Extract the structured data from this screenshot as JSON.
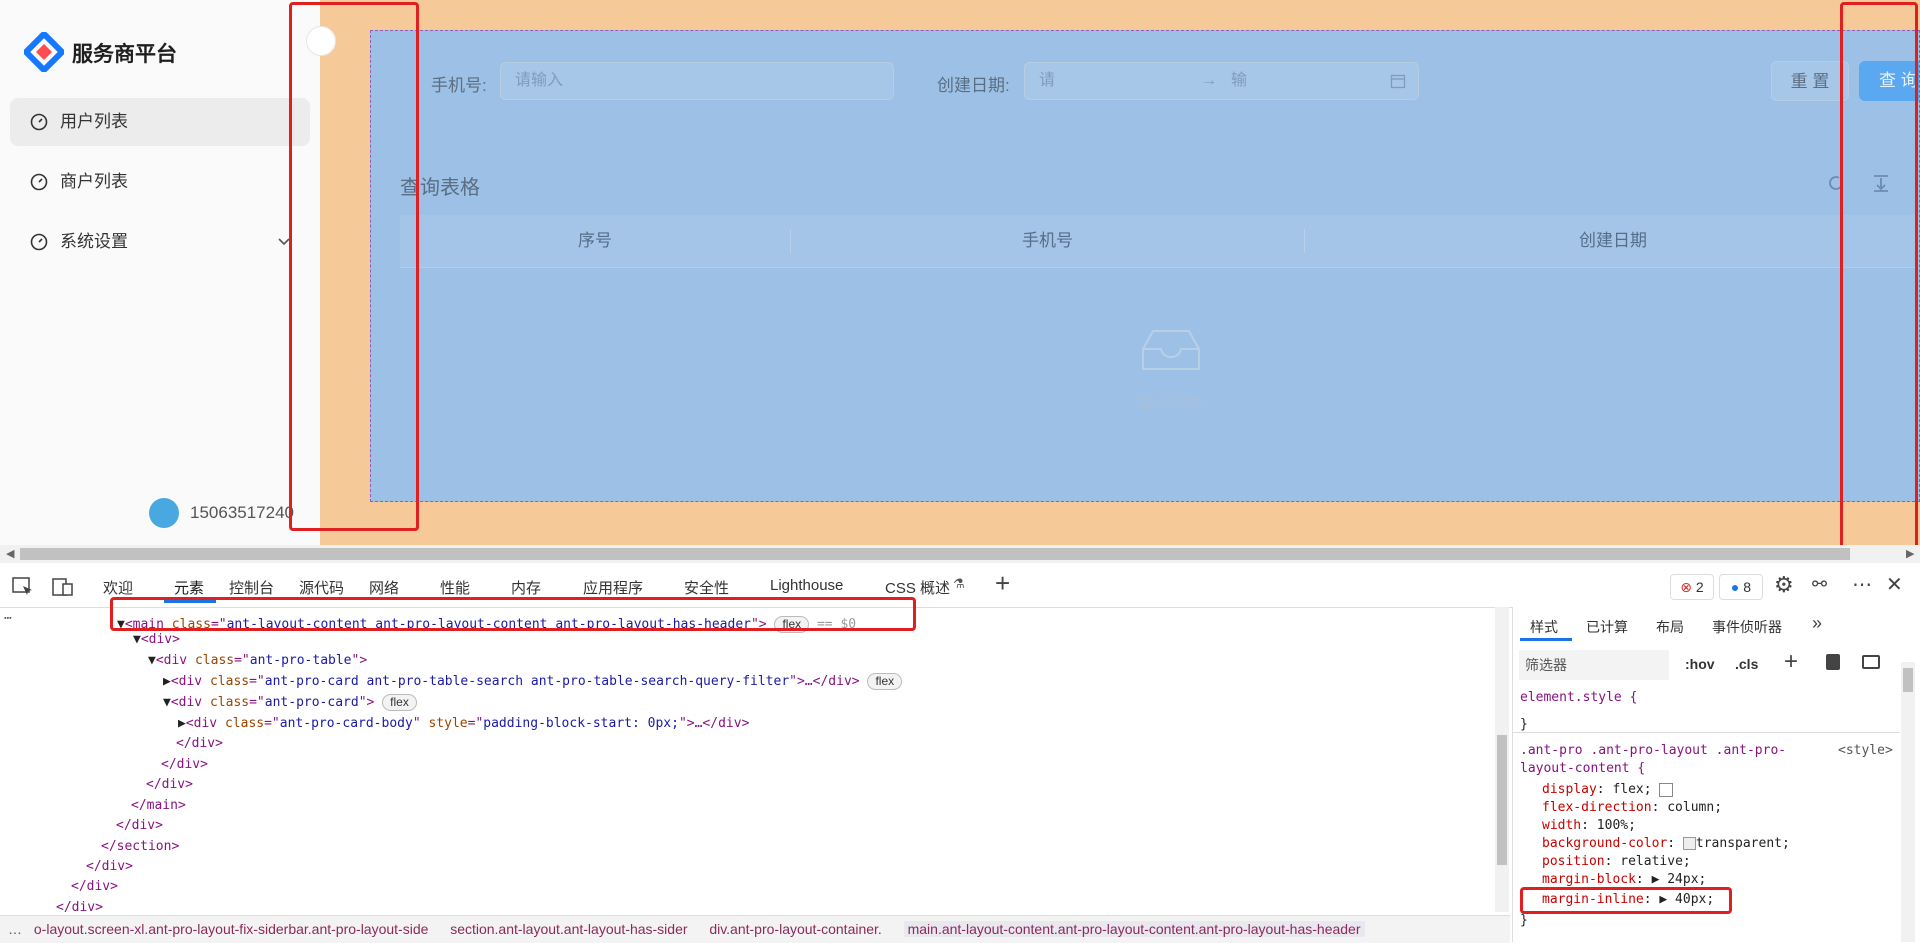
{
  "app": {
    "logo_text": "服务商平台",
    "menu": [
      {
        "label": "用户列表",
        "active": true
      },
      {
        "label": "商户列表",
        "active": false
      },
      {
        "label": "系统设置",
        "active": false,
        "has_submenu": true
      }
    ],
    "user_name": "15063517240",
    "search": {
      "phone_label": "手机号:",
      "phone_placeholder": "请输入",
      "date_label": "创建日期:",
      "date_start_placeholder": "请",
      "date_arrow": "→",
      "date_end_placeholder": "输",
      "reset_label": "重 置",
      "query_label": "查 询"
    },
    "table": {
      "title": "查询表格",
      "columns": [
        "序号",
        "手机号",
        "创建日期"
      ],
      "empty_text": "暂无数据"
    },
    "colors": {
      "margin_overlay": "#f6c999",
      "content_overlay": "#9dc1e6",
      "annotation_red": "#e02020",
      "accent": "#1a73e8"
    }
  },
  "devtools": {
    "tabs": [
      "欢迎",
      "元素",
      "控制台",
      "源代码",
      "网络",
      "性能",
      "内存",
      "应用程序",
      "安全性",
      "Lighthouse",
      "CSS 概述"
    ],
    "active_tab": "元素",
    "error_count": "2",
    "message_count": "8",
    "dom_lines": {
      "l0_tag": "main",
      "l0_class": "ant-layout-content ant-pro-layout-content ant-pro-layout-has-header",
      "l0_badge": "flex",
      "l0_suffix": "== $0",
      "l1": "<div>",
      "l2_class": "ant-pro-table",
      "l3_class": "ant-pro-card ant-pro-table-search ant-pro-table-search-query-filter",
      "l3_badge": "flex",
      "l4_class": "ant-pro-card",
      "l4_badge": "flex",
      "l5_class": "ant-pro-card-body",
      "l5_style": "padding-block-start: 0px;",
      "close_div": "</div>",
      "close_main": "</main>",
      "close_section": "</section>"
    },
    "breadcrumb": [
      "o-layout.screen-xl.ant-pro-layout-fix-siderbar.ant-pro-layout-side",
      "section.ant-layout.ant-layout-has-sider",
      "div.ant-pro-layout-container.",
      "main.ant-layout-content.ant-pro-layout-content.ant-pro-layout-has-header"
    ],
    "styles": {
      "tabs": [
        "样式",
        "已计算",
        "布局",
        "事件侦听器"
      ],
      "filter_placeholder": "筛选器",
      "hov": ":hov",
      "cls": ".cls",
      "element_style": "element.style {",
      "close_brace": "}",
      "rule_selector_1": ".ant-pro .ant-pro-layout .ant-pro-",
      "rule_selector_2": "layout-content {",
      "rule_source": "<style>",
      "declarations": [
        {
          "prop": "display",
          "value": "flex;"
        },
        {
          "prop": "flex-direction",
          "value": "column;"
        },
        {
          "prop": "width",
          "value": "100%;"
        },
        {
          "prop": "background-color",
          "value": "transparent;"
        },
        {
          "prop": "position",
          "value": "relative;"
        },
        {
          "prop": "margin-block",
          "value": "▶ 24px;"
        },
        {
          "prop": "margin-inline",
          "value": "▶ 40px;"
        }
      ]
    }
  }
}
